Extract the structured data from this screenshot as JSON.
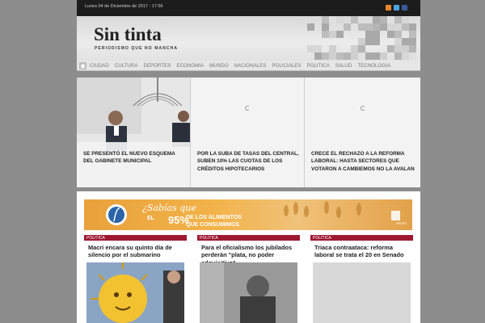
{
  "topbar": {
    "date": "Lunes 04 de Diciembre de 2017 - 17:56",
    "social_icons": [
      "rss-icon",
      "twitter-icon",
      "facebook-icon"
    ],
    "social_colors": [
      "#e8872b",
      "#4aa3df",
      "#3b5a9a"
    ]
  },
  "header": {
    "title": "Sin tinta",
    "subtitle": "PERIODISMO QUE NO MANCHA"
  },
  "nav": {
    "home_icon": "home-icon",
    "items": [
      "CIUDAD",
      "CULTURA",
      "DEPORTES",
      "ECONOMIA",
      "MUNDO",
      "NACIONALES",
      "POLICIALES",
      "POLITICA",
      "SALUD",
      "TECNOLOGIA"
    ]
  },
  "slider": [
    {
      "caption": "SE PRESENTÓ EL NUEVO ESQUEMA DEL GABINETE MUNICIPAL"
    },
    {
      "caption": "POR LA SUBA DE TASAS DEL CENTRAL, SUBEN 10% LAS CUOTAS DE LOS CRÉDITOS HIPOTECARIOS"
    },
    {
      "caption": "CRECE EL RECHAZO A LA REFORMA LABORAL: HASTA SECTORES QUE VOTARON A CAMBIEMOS NO LA AVALAN"
    }
  ],
  "banner": {
    "line1": "¿Sabías que",
    "line2": "EL",
    "percent": "95%",
    "line3": "DE LOS ALIMENTOS",
    "line4": "QUE CONSUMIMOS",
    "brand": "PROFIT"
  },
  "articles": [
    {
      "tag": "POLITICA",
      "title": "Macri encara su quinto día de silencio por el submarino"
    },
    {
      "tag": "POLITICA",
      "title": "Para el oficialismo los jubilados perderán \"plata, no poder adquisitivo\""
    },
    {
      "tag": "POLITICA",
      "title": "Triaca contraataca: reforma laboral se trata el 20 en Senado"
    }
  ],
  "colors": {
    "accent_red": "#9e1832",
    "topbar": "#1c1c1c",
    "banner_orange": "#f2b34a"
  }
}
